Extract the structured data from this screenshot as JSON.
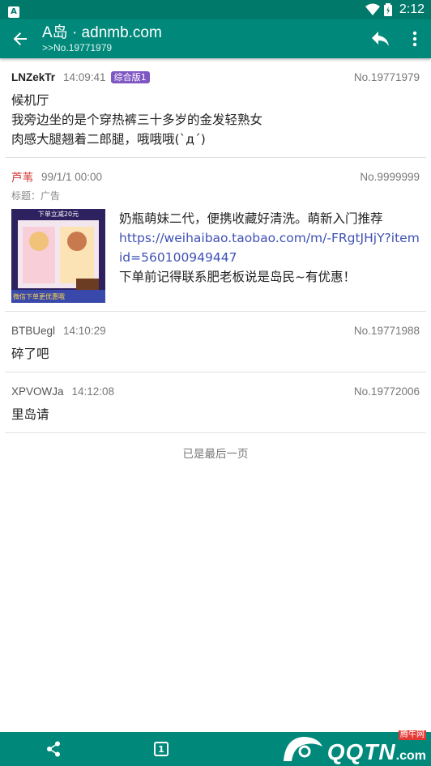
{
  "status_bar": {
    "notification": "A",
    "time": "2:12"
  },
  "app_bar": {
    "title": "A岛 · adnmb.com",
    "subtitle": ">>No.19771979"
  },
  "posts": [
    {
      "uid": "LNZekTr",
      "time": "14:09:41",
      "tag": "综合版1",
      "no": "No.19771979",
      "lines": [
        "候机厅",
        "我旁边坐的是个穿热裤三十多岁的金发轻熟女",
        "肉感大腿翘着二郎腿，哦哦哦(`д´)"
      ]
    },
    {
      "uid": "芦苇",
      "time": "99/1/1 00:00",
      "no": "No.9999999",
      "title_line": "标题：广告",
      "ad_text_1": "奶瓶萌妹二代，便携收藏好清洗。萌新入门推荐",
      "ad_link": "https://weihaibao.taobao.com/m/-FRgtJHjY?itemid=560100949447",
      "ad_text_2": "下单前记得联系肥老板说是岛民~有优惠！",
      "ad_image_top_text": "下单立减20元",
      "ad_image_bottom_text": "微信下单更优惠哦"
    },
    {
      "uid": "BTBUegl",
      "time": "14:10:29",
      "no": "No.19771988",
      "lines": [
        "碎了吧"
      ]
    },
    {
      "uid": "XPVOWJa",
      "time": "14:12:08",
      "no": "No.19772006",
      "lines": [
        "里岛请"
      ]
    }
  ],
  "footer_note": "已是最后一页",
  "bottom_bar": {
    "page_badge": "1"
  },
  "watermark": {
    "brand": "QQTN",
    "domain_suffix": ".com",
    "tagline": "腾牛网"
  },
  "colors": {
    "primary": "#00897b",
    "status_bar": "#00796b",
    "tag_bg": "#7e57c2",
    "link": "#3f51b5",
    "red_user": "#d32f2f"
  }
}
